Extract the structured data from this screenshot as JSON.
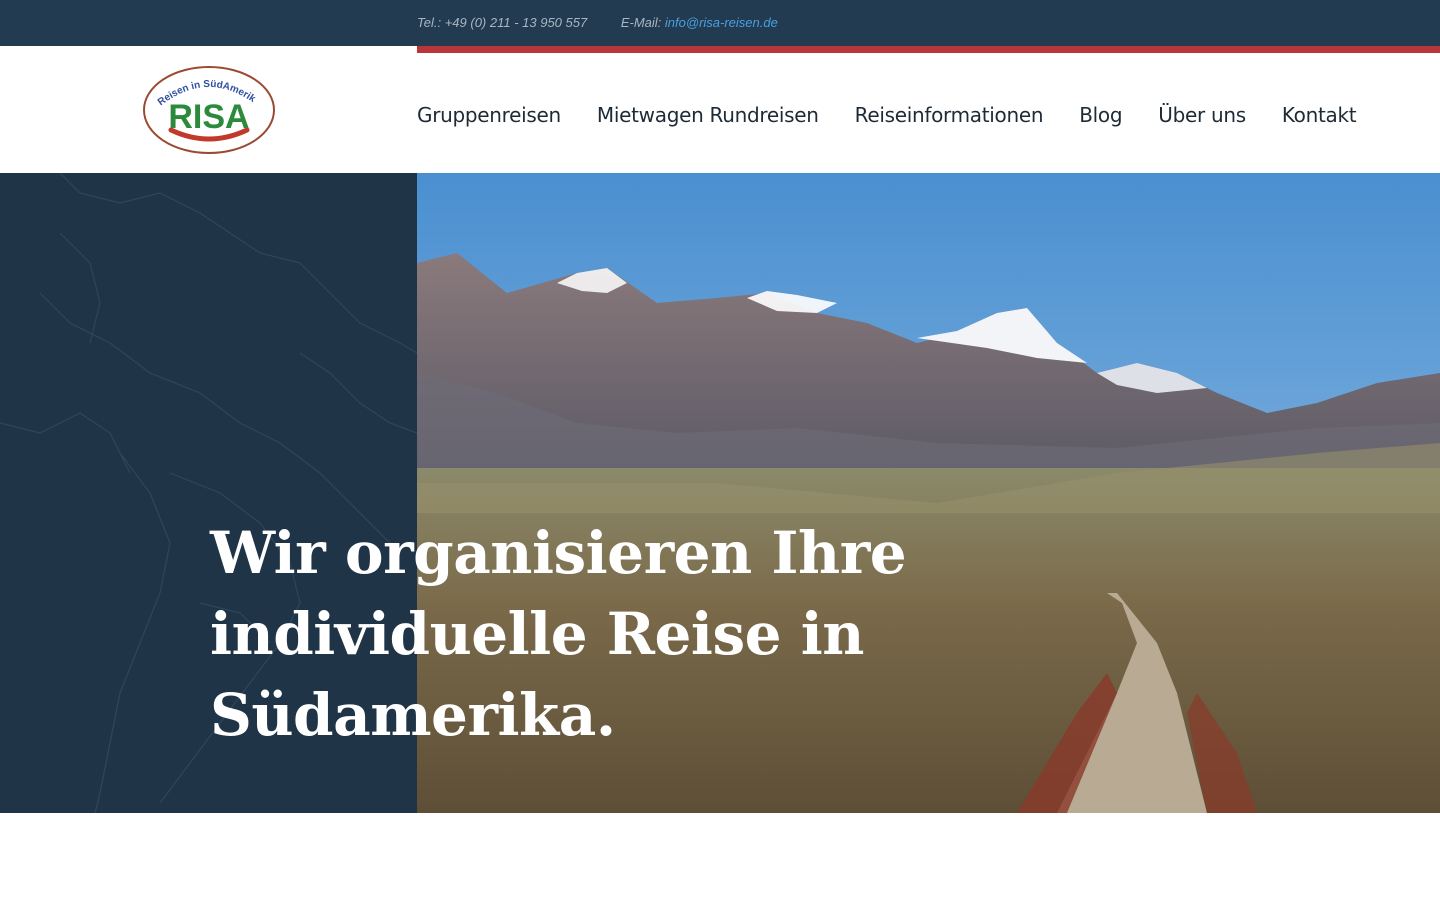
{
  "topbar": {
    "phone": "Tel.: +49 (0) 211 - 13 950 557",
    "email_label": "E-Mail:",
    "email": "info@risa-reisen.de"
  },
  "logo": {
    "name": "RISA",
    "tagline": "Reisen in SüdAmerika"
  },
  "nav": {
    "items": [
      {
        "label": "Gruppenreisen"
      },
      {
        "label": "Mietwagen Rundreisen"
      },
      {
        "label": "Reiseinformationen"
      },
      {
        "label": "Blog"
      },
      {
        "label": "Über uns"
      },
      {
        "label": "Kontakt"
      }
    ]
  },
  "hero": {
    "headline_lines": [
      "Wir organisieren Ihre",
      "individuelle Reise in",
      "Südamerika."
    ]
  },
  "colors": {
    "topbar": "#233b50",
    "accent_red": "#b8353b",
    "hero_dark": "#1f3447",
    "link_blue": "#4a9fe0",
    "logo_green": "#2c8a3c",
    "logo_red": "#c0392b"
  }
}
